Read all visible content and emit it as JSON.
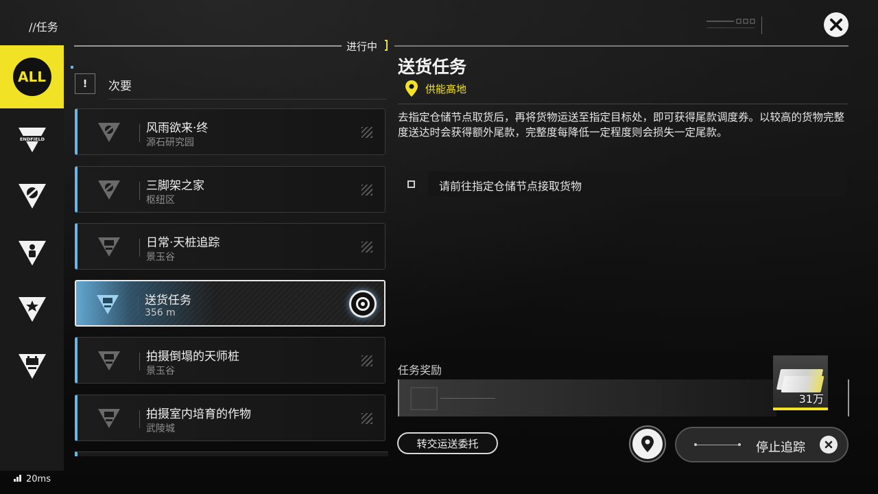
{
  "header": {
    "title": "//任务",
    "status_label": "进行中",
    "close_icon": "close-x-icon"
  },
  "sidebar": {
    "items": [
      {
        "label": "ALL",
        "icon": "all-filter-icon",
        "selected": true
      },
      {
        "label": "ENDFIELD",
        "icon": "endfield-category-icon"
      },
      {
        "label": "",
        "icon": "side-quest-category-icon"
      },
      {
        "label": "",
        "icon": "character-category-icon"
      },
      {
        "label": "",
        "icon": "star-category-icon"
      },
      {
        "label": "",
        "icon": "daily-category-icon"
      }
    ],
    "ping": "20ms"
  },
  "quest_list": {
    "category_icon_text": "!",
    "category_label": "次要",
    "quests": [
      {
        "name": "风雨欲来·终",
        "sub": "源石研究园",
        "icon": "side-quest-icon",
        "active": false
      },
      {
        "name": "三脚架之家",
        "sub": "枢纽区",
        "icon": "side-quest-icon",
        "active": false
      },
      {
        "name": "日常·天桩追踪",
        "sub": "景玉谷",
        "icon": "daily-quest-icon",
        "active": false
      },
      {
        "name": "送货任务",
        "sub": "356 m",
        "icon": "daily-quest-icon",
        "active": true
      },
      {
        "name": "拍摄倒塌的天师桩",
        "sub": "景玉谷",
        "icon": "daily-quest-icon",
        "active": false
      },
      {
        "name": "拍摄室内培育的作物",
        "sub": "武陵城",
        "icon": "daily-quest-icon",
        "active": false
      }
    ]
  },
  "detail": {
    "title": "送货任务",
    "location": "供能高地",
    "description": "去指定仓储节点取货后，再将货物运送至指定目标处，即可获得尾款调度券。以较高的货物完整度送达时会获得额外尾款，完整度每降低一定程度则会损失一定尾款。",
    "objective": "请前往指定仓储节点接取货物",
    "reward_label": "任务奖励",
    "reward_quantity": "31万"
  },
  "actions": {
    "transfer_label": "转交运送委托",
    "stop_label": "停止追踪"
  },
  "colors": {
    "accent_yellow": "#f1e226",
    "accent_blue": "#6ab7e6"
  }
}
